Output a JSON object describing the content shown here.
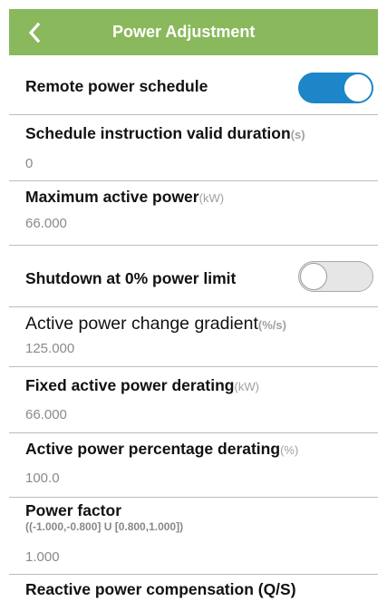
{
  "header": {
    "title": "Power Adjustment",
    "back_icon": "chevron-left-icon",
    "background_color": "#8ab85c"
  },
  "accent_color": "#1c86c8",
  "settings": {
    "remote_power_schedule": {
      "label": "Remote power schedule",
      "enabled": true
    },
    "schedule_valid_duration": {
      "label": "Schedule instruction valid duration",
      "unit": "(s)",
      "value": "0"
    },
    "max_active_power": {
      "label": "Maximum active power",
      "unit": "(kW)",
      "value": "66.000"
    },
    "shutdown_zero_limit": {
      "label": "Shutdown at 0% power limit",
      "enabled": false
    },
    "active_power_gradient": {
      "label": "Active power change gradient",
      "unit": "(%/s)",
      "value": "125.000"
    },
    "fixed_active_derating": {
      "label": "Fixed active power derating",
      "unit": "(kW)",
      "value": "66.000"
    },
    "percentage_derating": {
      "label": "Active power percentage derating",
      "unit": "(%)",
      "value": "100.0"
    },
    "power_factor": {
      "label": "Power factor",
      "range": "((-1.000,-0.800] U [0.800,1.000])",
      "value": "1.000"
    },
    "reactive_compensation": {
      "label": "Reactive power compensation (Q/S)"
    }
  }
}
